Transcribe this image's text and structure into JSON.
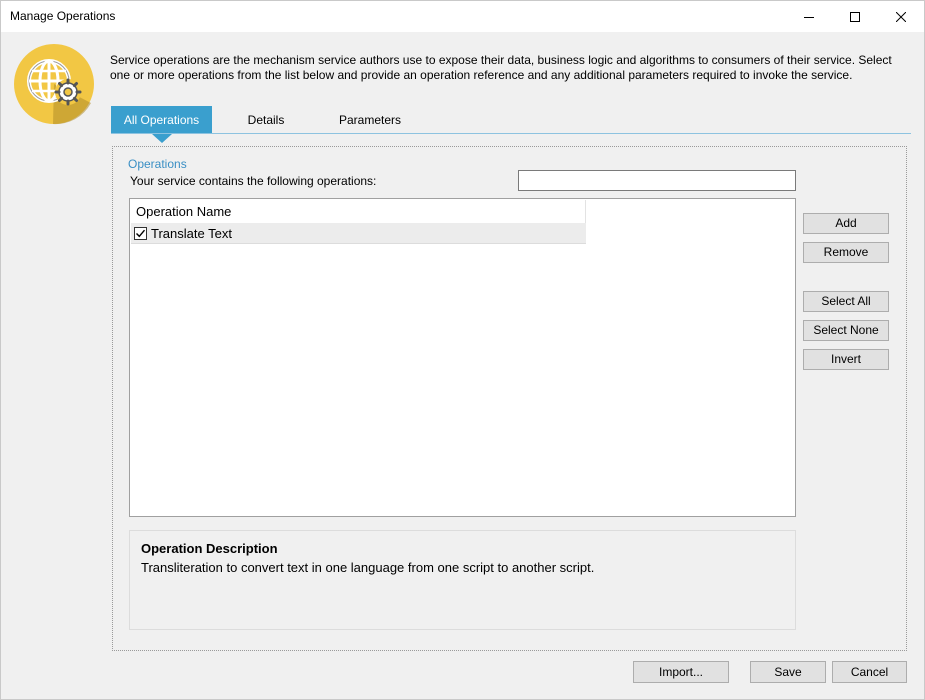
{
  "window": {
    "title": "Manage Operations"
  },
  "intro": {
    "text": "Service operations are the mechanism service authors use to expose their data, business logic and algorithms to consumers of their service. Select one or more operations from the list below and provide an operation reference and any additional parameters required to invoke the service."
  },
  "tabs": [
    {
      "label": "All Operations",
      "active": true
    },
    {
      "label": "Details",
      "active": false
    },
    {
      "label": "Parameters",
      "active": false
    }
  ],
  "operations": {
    "section_label": "Operations",
    "contains_text": "Your service contains the following operations:",
    "search_value": "",
    "column_header": "Operation Name",
    "rows": [
      {
        "name": "Translate Text",
        "checked": true
      }
    ]
  },
  "side_buttons": {
    "add": "Add",
    "remove": "Remove",
    "select_all": "Select All",
    "select_none": "Select None",
    "invert": "Invert"
  },
  "description": {
    "title": "Operation Description",
    "text": "Transliteration to convert text in one language from one script to another script."
  },
  "footer": {
    "import": "Import...",
    "save": "Save",
    "cancel": "Cancel"
  },
  "colors": {
    "accent": "#3a9fce",
    "logo_circle": "#f2c744",
    "logo_globe": "#9b9b9b"
  },
  "icons": {
    "logo": "globe-gear-icon",
    "minimize": "minimize-icon",
    "maximize": "maximize-icon",
    "close": "close-icon",
    "check": "checkmark-icon"
  }
}
